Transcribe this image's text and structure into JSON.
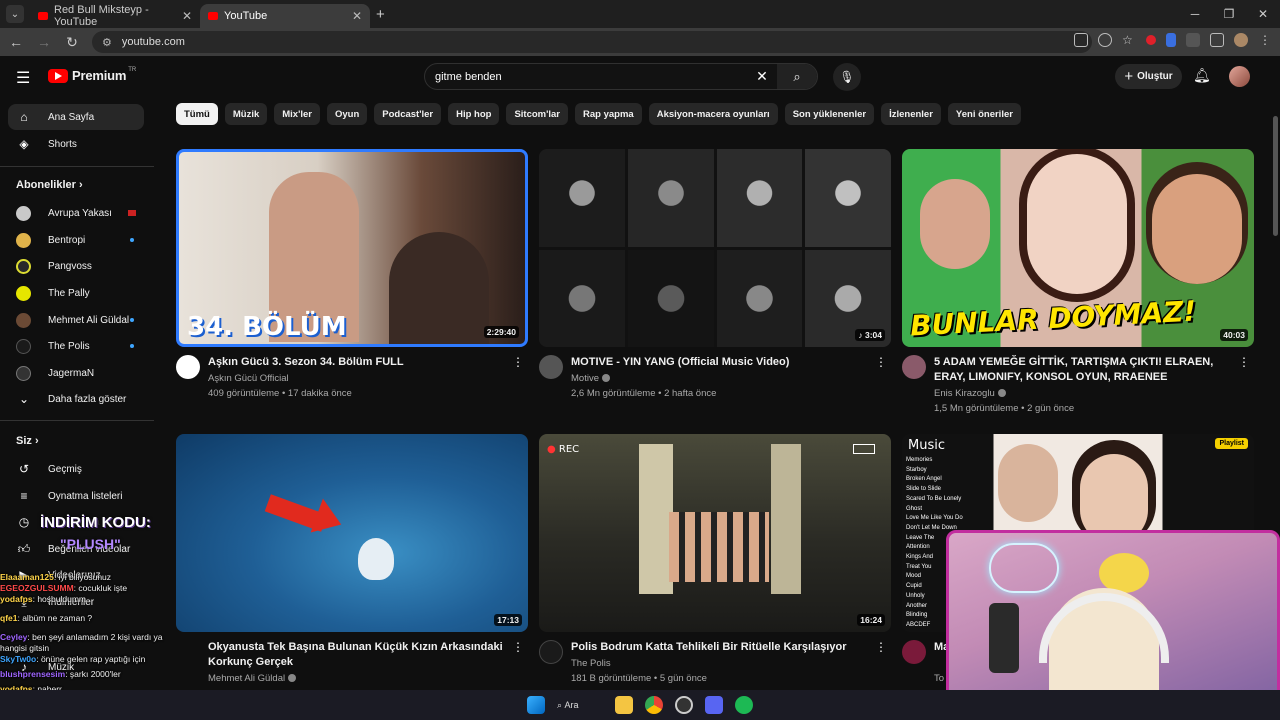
{
  "browser": {
    "tabs": [
      {
        "title": "Red Bull Miksteyp - YouTube",
        "active": false
      },
      {
        "title": "YouTube",
        "active": true
      }
    ],
    "url": "youtube.com"
  },
  "masthead": {
    "logo_text": "Premium",
    "region": "TR",
    "search_value": "gitme benden",
    "create_label": "Oluştur"
  },
  "sidebar": {
    "main": [
      {
        "label": "Ana Sayfa",
        "icon": "home-icon"
      },
      {
        "label": "Shorts",
        "icon": "shorts-icon"
      }
    ],
    "subscriptions_title": "Abonelikler",
    "subscriptions": [
      {
        "label": "Avrupa Yakası",
        "color": "#c9c9c9",
        "live": false
      },
      {
        "label": "Bentropi",
        "color": "#e0b34a",
        "live": true
      },
      {
        "label": "Pangvoss",
        "color": "#2a2a2a",
        "live": false
      },
      {
        "label": "The Pally",
        "color": "#e6e600",
        "live": false
      },
      {
        "label": "Mehmet Ali Güldal",
        "color": "#6b4a35",
        "live": true
      },
      {
        "label": "The Polis",
        "color": "#1a1a1a",
        "live": true
      },
      {
        "label": "JagermaN",
        "color": "#333333",
        "live": false
      }
    ],
    "show_more": "Daha fazla göster",
    "you_title": "Siz",
    "you_items": [
      {
        "label": "Geçmiş",
        "icon": "history-icon"
      },
      {
        "label": "Oynatma listeleri",
        "icon": "playlist-icon"
      },
      {
        "label": "Daha sonra izle",
        "icon": "watch-later-icon"
      },
      {
        "label": "Beğenilen videolar",
        "icon": "like-icon"
      },
      {
        "label": "Videolarınız",
        "icon": "your-videos-icon"
      },
      {
        "label": "İndirilenler",
        "icon": "download-icon"
      },
      {
        "label": "Müzik",
        "icon": "music-icon"
      }
    ]
  },
  "chips": [
    "Tümü",
    "Müzik",
    "Mix'ler",
    "Oyun",
    "Podcast'ler",
    "Hip hop",
    "Sitcom'lar",
    "Rap yapma",
    "Aksiyon-macera oyunları",
    "Son yüklenenler",
    "İzlenenler",
    "Yeni öneriler"
  ],
  "videos": [
    {
      "title": "Aşkın Gücü 3. Sezon 34. Bölüm FULL",
      "channel": "Aşkın Gücü Official",
      "verified": false,
      "stats": "409 görüntüleme • 17 dakika önce",
      "duration": "2:29:40",
      "overlay": "34. BÖLÜM",
      "channel_color": "#ffffff"
    },
    {
      "title": "MOTIVE - YIN YANG (Official Music Video)",
      "channel": "Motive",
      "verified": true,
      "stats": "2,6 Mn görüntüleme • 2 hafta önce",
      "duration": "3:04",
      "overlay": "",
      "channel_color": "#555555"
    },
    {
      "title": "5 ADAM YEMEĞE GİTTİK, TARTIŞMA ÇIKTI! ELRAEN, ERAY, LIMONIFY, KONSOL OYUN, RRAENEE",
      "channel": "Enis Kirazoglu",
      "verified": true,
      "stats": "1,5 Mn görüntüleme • 2 gün önce",
      "duration": "40:03",
      "overlay": "BUNLAR DOYMAZ!",
      "channel_color": "#8a5a6a"
    },
    {
      "title": "Okyanusta Tek Başına Bulunan Küçük Kızın Arkasındaki Korkunç Gerçek",
      "channel": "Mehmet Ali Güldal",
      "verified": true,
      "stats": "",
      "duration": "17:13",
      "overlay": "",
      "channel_color": "#6b4a35"
    },
    {
      "title": "Polis Bodrum Katta Tehlikeli Bir Ritüelle Karşılaşıyor",
      "channel": "The Polis",
      "verified": false,
      "stats": "181 B görüntüleme • 5 gün önce",
      "duration": "16:24",
      "overlay": "REC",
      "channel_color": "#1a1a1a"
    },
    {
      "title": "Ma",
      "channel": "To",
      "verified": false,
      "stats": "",
      "duration": "",
      "overlay": "Music",
      "channel_color": "#7a1a3a"
    }
  ],
  "playlist_tracks": [
    "Memories",
    "Starboy",
    "Broken Angel",
    "Slide to Slide",
    "Scared To Be Lonely",
    "Ghost",
    "Love Me Like You Do",
    "Don't Let Me Down",
    "Leave The",
    "Attention",
    "Kings And",
    "Treat You",
    "Mood",
    "Cupid",
    "Unholy",
    "Another",
    "Blinding",
    "ABCDEF"
  ],
  "playlist_badge": "Playlist",
  "overlay_promo": {
    "line1": "İNDİRİM KODU:",
    "line2": "\"PLUSH\""
  },
  "chat": [
    {
      "user": "Elaaaman125",
      "msg": ": iyi biliyosunuz",
      "color": "#ffd54a"
    },
    {
      "user": "EGEOZGULSUMM",
      "msg": ": cocukluk işte",
      "color": "#ff4a4a"
    },
    {
      "user": "yodafps",
      "msg": ": hoşbuldumm",
      "color": "#ffd54a"
    },
    {
      "user": "qfe1",
      "msg": ": albüm ne zaman ?",
      "color": "#ffd54a"
    },
    {
      "user": "Ceyley",
      "msg": ": ben şeyi anlamadım 2 kişi vardı ya hangisi gitsin",
      "color": "#a066ff"
    },
    {
      "user": "SkyTw0o",
      "msg": ": önüne gelen rap yaptığı için",
      "color": "#3ea6ff"
    },
    {
      "user": "blushprensesim",
      "msg": ": şarkı 2000'ler",
      "color": "#a066ff"
    },
    {
      "user": "yodafps",
      "msg": ": naberr",
      "color": "#ffd54a"
    }
  ],
  "taskbar": {
    "search_label": "Ara"
  },
  "colors": {
    "accent": "#ff0000",
    "live": "#3ea6ff",
    "webcam_border": "#c22e9f"
  }
}
